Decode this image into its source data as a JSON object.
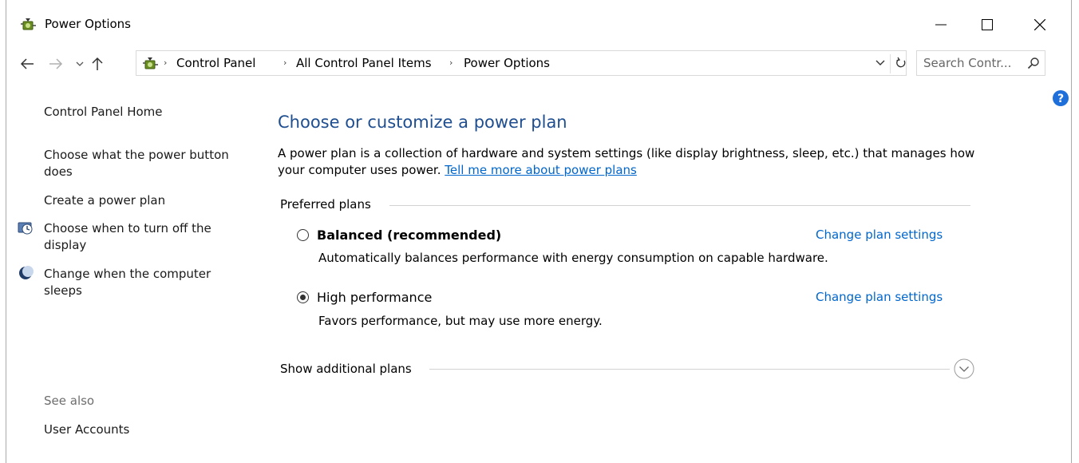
{
  "window": {
    "title": "Power Options",
    "minimize_glyph": "—",
    "close_glyph": "✕"
  },
  "address": {
    "crumbs": [
      "Control Panel",
      "All Control Panel Items",
      "Power Options"
    ],
    "search_placeholder": "Search Contr..."
  },
  "left_nav": {
    "home": "Control Panel Home",
    "links": [
      "Choose what the power button does",
      "Create a power plan",
      "Choose when to turn off the display",
      "Change when the computer sleeps"
    ],
    "see_also_label": "See also",
    "see_also_links": [
      "User Accounts"
    ]
  },
  "main": {
    "title": "Choose or customize a power plan",
    "description": "A power plan is a collection of hardware and system settings (like display brightness, sleep, etc.) that manages how your computer uses power.",
    "more_link": "Tell me more about power plans",
    "preferred_label": "Preferred plans",
    "plans": [
      {
        "name": "Balanced (recommended)",
        "description": "Automatically balances performance with energy consumption on capable hardware.",
        "link": "Change plan settings",
        "selected": false
      },
      {
        "name": "High performance",
        "description": "Favors performance, but may use more energy.",
        "link": "Change plan settings",
        "selected": true
      }
    ],
    "additional_label": "Show additional plans"
  },
  "colors": {
    "title_blue": "#1e4e90",
    "link_blue": "#0066cc",
    "help_blue": "#1e6fd9"
  }
}
